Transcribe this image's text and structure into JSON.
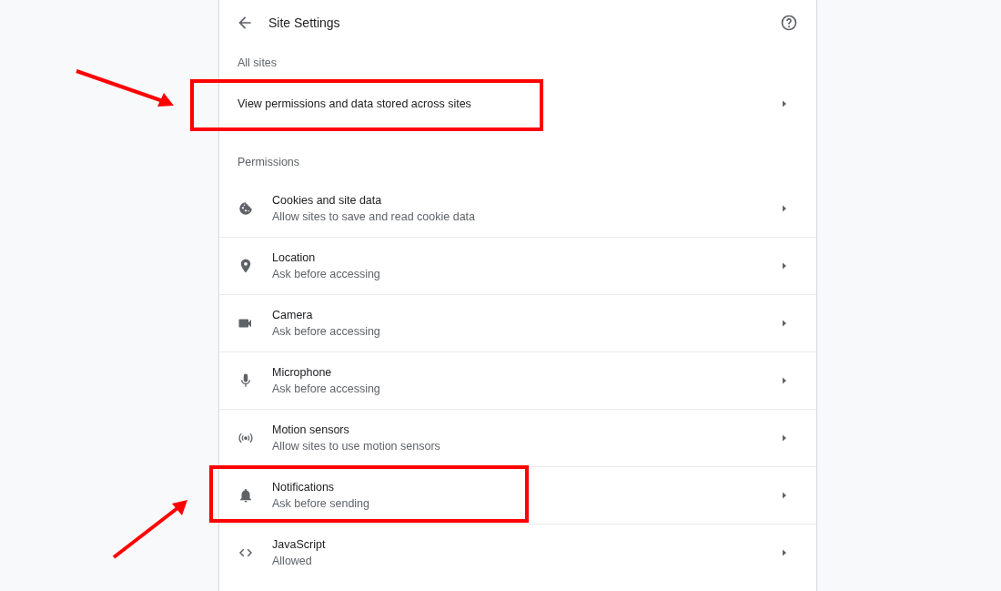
{
  "header": {
    "title": "Site Settings"
  },
  "sections": [
    {
      "label": "All sites",
      "rows": [
        {
          "kind": "plain",
          "title": "View permissions and data stored across sites",
          "highlighted": true,
          "arrow_from_below": false
        }
      ]
    },
    {
      "label": "Permissions",
      "rows": [
        {
          "kind": "cookie",
          "title": "Cookies and site data",
          "subtitle": "Allow sites to save and read cookie data",
          "highlighted": false
        },
        {
          "kind": "location",
          "title": "Location",
          "subtitle": "Ask before accessing",
          "highlighted": false
        },
        {
          "kind": "camera",
          "title": "Camera",
          "subtitle": "Ask before accessing",
          "highlighted": false
        },
        {
          "kind": "microphone",
          "title": "Microphone",
          "subtitle": "Ask before accessing",
          "highlighted": false
        },
        {
          "kind": "motion",
          "title": "Motion sensors",
          "subtitle": "Allow sites to use motion sensors",
          "highlighted": false
        },
        {
          "kind": "notifications",
          "title": "Notifications",
          "subtitle": "Ask before sending",
          "highlighted": true,
          "arrow_from_below": true
        },
        {
          "kind": "javascript",
          "title": "JavaScript",
          "subtitle": "Allowed",
          "highlighted": false
        }
      ]
    }
  ]
}
